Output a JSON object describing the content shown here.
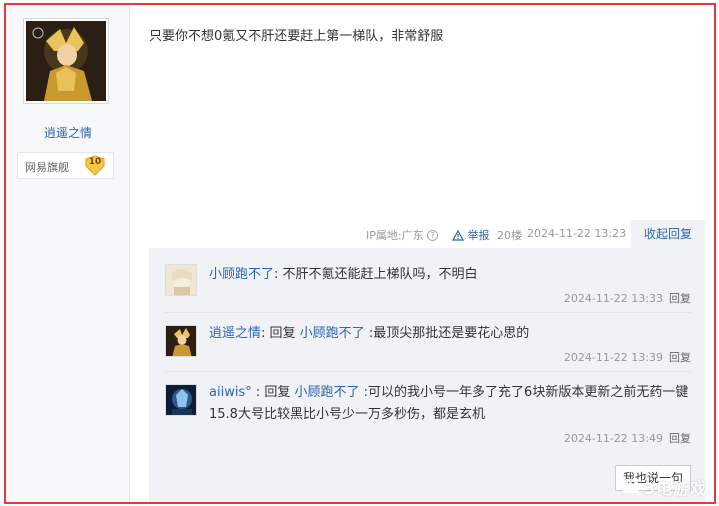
{
  "post": {
    "author": "逍遥之情",
    "badge_name": "网易旗舰",
    "badge_level": "10",
    "content": "只要你不想0氪又不肝还要赶上第一梯队，非常舒服",
    "ip_location": "IP属地:广东",
    "report_label": "举报",
    "floor": "20楼",
    "timestamp": "2024-11-22 13:23",
    "collapse_label": "收起回复"
  },
  "replies": [
    {
      "user": "小顾跑不了",
      "separator": ": ",
      "reply_prefix": "",
      "reply_to": "",
      "text": "不肝不氪还能赶上梯队吗，不明白",
      "time": "2024-11-22 13:33",
      "reply_label": "回复"
    },
    {
      "user": "逍遥之情",
      "separator": ": ",
      "reply_prefix": "回复 ",
      "reply_to": "小顾跑不了",
      "text": " :最顶尖那批还是要花心思的",
      "time": "2024-11-22 13:39",
      "reply_label": "回复"
    },
    {
      "user": "aiiwis°",
      "separator": " : ",
      "reply_prefix": "回复 ",
      "reply_to": "小顾跑不了",
      "text": " :可以的我小号一年多了充了6块新版本更新之前无药一键15.8大号比较黑比小号少一万多秒伤，都是玄机",
      "time": "2024-11-22 13:49",
      "reply_label": "回复"
    }
  ],
  "say_button": "我也说一句",
  "watermark": "3电游戏",
  "colors": {
    "frame_border": "#e03a3a",
    "link": "#2d64b3",
    "reply_bg": "#f0f2f5"
  }
}
